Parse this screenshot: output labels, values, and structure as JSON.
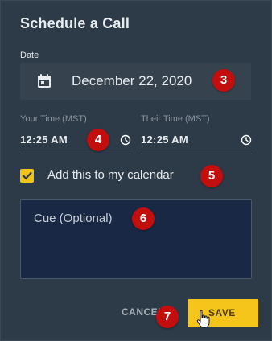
{
  "dialog": {
    "title": "Schedule a Call",
    "date_label": "Date",
    "date_value": "December 22, 2020",
    "your_time_label": "Your Time (MST)",
    "your_time_value": "12:25 AM",
    "their_time_label": "Their Time (MST)",
    "their_time_value": "12:25 AM",
    "calendar_checkbox_label": "Add this to my calendar",
    "calendar_checked": true,
    "cue_placeholder": "Cue (Optional)",
    "cancel_label": "CANCEL",
    "save_label": "SAVE"
  },
  "annotations": {
    "date": "3",
    "time": "4",
    "checkbox": "5",
    "cue": "6",
    "buttons": "7"
  },
  "colors": {
    "dialog_background": "#2d3a47",
    "accent_yellow": "#f5c51b",
    "cue_background": "#192845",
    "annotation_red": "#c30e0e"
  },
  "icons": {
    "date": "calendar-icon",
    "time": "clock-icon",
    "checkbox": "checkmark-icon",
    "pointer": "hand-cursor-icon"
  }
}
